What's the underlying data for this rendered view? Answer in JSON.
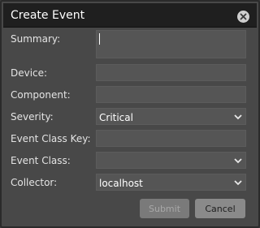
{
  "dialog": {
    "title": "Create Event",
    "close_icon": "close-circle-icon"
  },
  "form": {
    "summary": {
      "label": "Summary:",
      "value": ""
    },
    "device": {
      "label": "Device:",
      "value": ""
    },
    "component": {
      "label": "Component:",
      "value": ""
    },
    "severity": {
      "label": "Severity:",
      "value": "Critical"
    },
    "event_class_key": {
      "label": "Event Class Key:",
      "value": ""
    },
    "event_class": {
      "label": "Event Class:",
      "value": ""
    },
    "collector": {
      "label": "Collector:",
      "value": "localhost"
    }
  },
  "buttons": {
    "submit": "Submit",
    "cancel": "Cancel"
  }
}
